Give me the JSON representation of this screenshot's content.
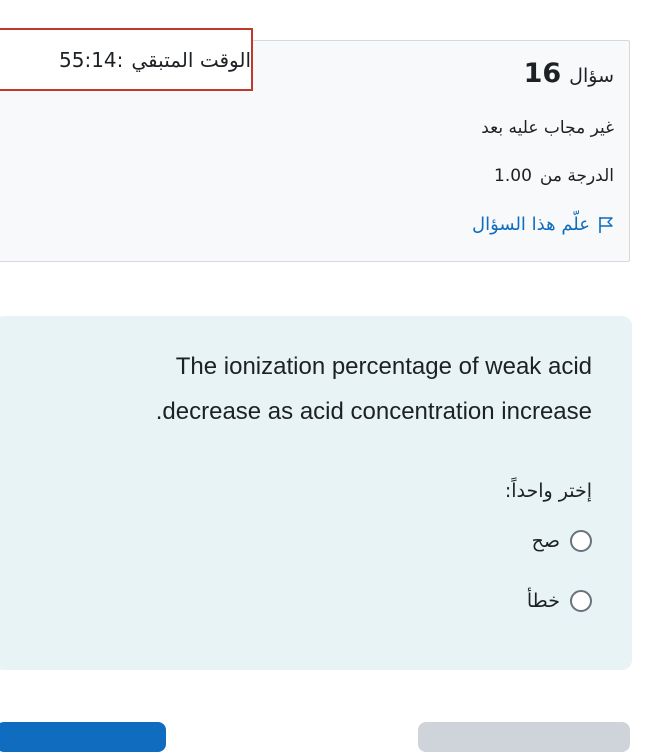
{
  "timer": {
    "label": "الوقت المتبقي",
    "value": "55:14:"
  },
  "question_info": {
    "label": "سؤال",
    "number": "16",
    "state": "غير مجاب عليه بعد",
    "grade_label": "الدرجة من",
    "grade_value": "1.00",
    "flag_label": "علّم هذا السؤال",
    "flag_icon": "flag-icon"
  },
  "question": {
    "line1": "The ionization percentage of weak acid",
    "line2": ".decrease as acid concentration increase",
    "prompt": "إختر واحداً:",
    "options": [
      {
        "label": "صح"
      },
      {
        "label": "خطأ"
      }
    ]
  },
  "colors": {
    "accent": "#0f6cbf",
    "timer_border": "#c0392b",
    "question_bg": "#e7f3f5"
  }
}
